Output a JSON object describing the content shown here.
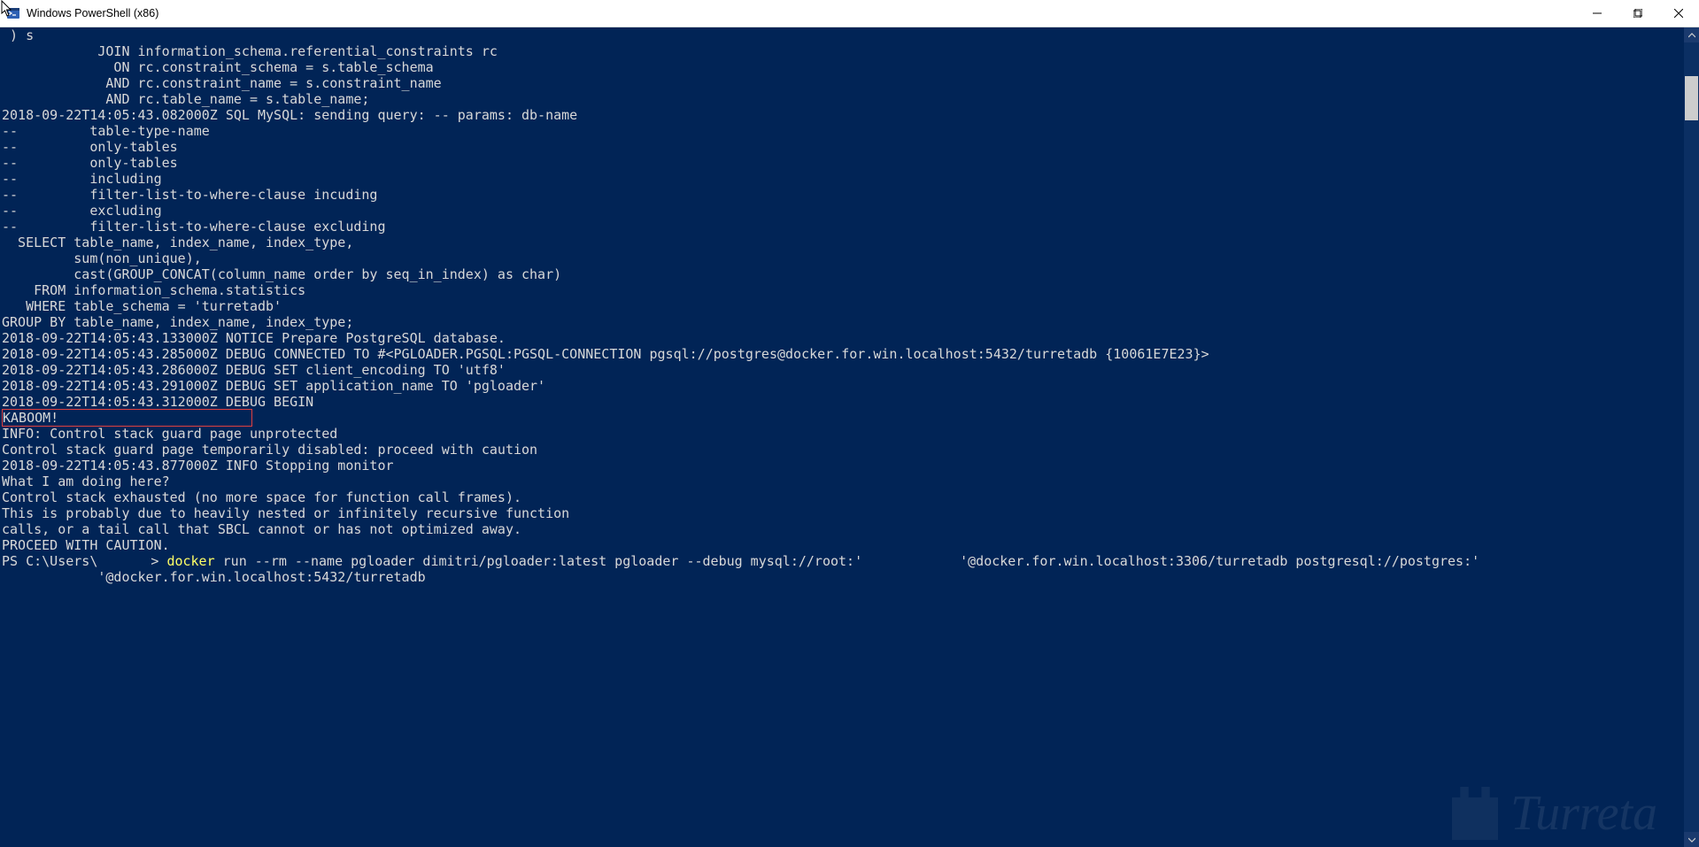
{
  "window": {
    "title": "Windows PowerShell (x86)"
  },
  "colors": {
    "terminal_bg": "#012456",
    "terminal_fg": "#d8d8d8",
    "highlight_yellow": "#ffff66"
  },
  "highlight_box_text": "KABOOM!",
  "terminal_lines": [
    " ) s",
    "            JOIN information_schema.referential_constraints rc",
    "              ON rc.constraint_schema = s.table_schema",
    "             AND rc.constraint_name = s.constraint_name",
    "             AND rc.table_name = s.table_name;",
    "2018-09-22T14:05:43.082000Z SQL MySQL: sending query: -- params: db-name",
    "--         table-type-name",
    "--         only-tables",
    "--         only-tables",
    "--         including",
    "--         filter-list-to-where-clause incuding",
    "--         excluding",
    "--         filter-list-to-where-clause excluding",
    "  SELECT table_name, index_name, index_type,",
    "         sum(non_unique),",
    "         cast(GROUP_CONCAT(column_name order by seq_in_index) as char)",
    "    FROM information_schema.statistics",
    "   WHERE table_schema = 'turretadb'",
    "",
    "",
    "",
    "GROUP BY table_name, index_name, index_type;",
    "2018-09-22T14:05:43.133000Z NOTICE Prepare PostgreSQL database.",
    "2018-09-22T14:05:43.285000Z DEBUG CONNECTED TO #<PGLOADER.PGSQL:PGSQL-CONNECTION pgsql://postgres@docker.for.win.localhost:5432/turretadb {10061E7E23}>",
    "2018-09-22T14:05:43.286000Z DEBUG SET client_encoding TO 'utf8'",
    "2018-09-22T14:05:43.291000Z DEBUG SET application_name TO 'pgloader'",
    "2018-09-22T14:05:43.312000Z DEBUG BEGIN"
  ],
  "terminal_lines_after": [
    "INFO: Control stack guard page unprotected",
    "Control stack guard page temporarily disabled: proceed with caution",
    "2018-09-22T14:05:43.877000Z INFO Stopping monitor",
    "",
    "What I am doing here?",
    "",
    "Control stack exhausted (no more space for function call frames).",
    "This is probably due to heavily nested or infinitely recursive function",
    "calls, or a tail call that SBCL cannot or has not optimized away.",
    "",
    "PROCEED WITH CAUTION.",
    ""
  ],
  "prompt": {
    "prefix": "PS C:\\Users\\",
    "sep": "> ",
    "command_keyword": "docker",
    "command_rest_1": " run --rm --name pgloader dimitri/pgloader:latest pgloader --debug mysql://root:'",
    "command_rest_2": "'@docker.for.win.localhost:3306/turretadb postgresql://postgres:'",
    "continuation": "            '@docker.for.win.localhost:5432/turretadb"
  },
  "watermark_text": "Turreta"
}
